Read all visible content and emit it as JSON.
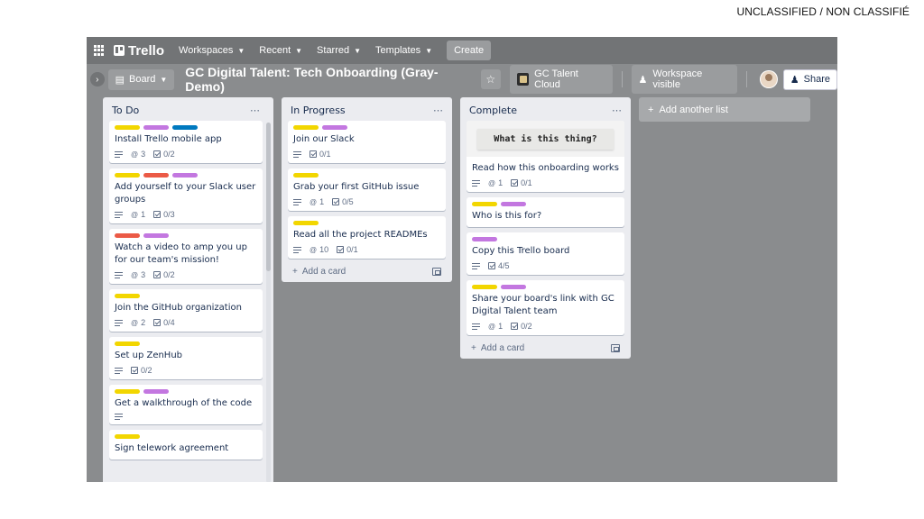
{
  "classification": "UNCLASSIFIED / NON CLASSIFIÉ",
  "colors": {
    "yellow": "#f2d600",
    "purple": "#c377e0",
    "blue": "#0079bf",
    "red": "#eb5a46"
  },
  "topnav": {
    "logo": "Trello",
    "items": [
      "Workspaces",
      "Recent",
      "Starred",
      "Templates"
    ],
    "create": "Create"
  },
  "boardbar": {
    "view": "Board",
    "title": "GC Digital Talent: Tech Onboarding (Gray-Demo)",
    "workspace": "GC Talent Cloud",
    "visibility": "Workspace visible",
    "share": "Share"
  },
  "lists": {
    "todo": {
      "title": "To Do",
      "cards": [
        {
          "title": "Install Trello mobile app",
          "labels": [
            "yellow",
            "purple",
            "blue"
          ],
          "attachments": "3",
          "checklist": "0/2"
        },
        {
          "title": "Add yourself to your Slack user groups",
          "labels": [
            "yellow",
            "red",
            "purple"
          ],
          "attachments": "1",
          "checklist": "0/3"
        },
        {
          "title": "Watch a video to amp you up for our team's mission!",
          "labels": [
            "red",
            "purple"
          ],
          "attachments": "3",
          "checklist": "0/2"
        },
        {
          "title": "Join the GitHub organization",
          "labels": [
            "yellow"
          ],
          "attachments": "2",
          "checklist": "0/4"
        },
        {
          "title": "Set up ZenHub",
          "labels": [
            "yellow"
          ],
          "checklist": "0/2"
        },
        {
          "title": "Get a walkthrough of the code",
          "labels": [
            "yellow",
            "purple"
          ]
        },
        {
          "title": "Sign telework agreement",
          "labels": [
            "yellow"
          ]
        }
      ]
    },
    "inprogress": {
      "title": "In Progress",
      "cards": [
        {
          "title": "Join our Slack",
          "labels": [
            "yellow",
            "purple"
          ],
          "checklist": "0/1"
        },
        {
          "title": "Grab your first GitHub issue",
          "labels": [
            "yellow"
          ],
          "attachments": "1",
          "checklist": "0/5"
        },
        {
          "title": "Read all the project READMEs",
          "labels": [
            "yellow"
          ],
          "attachments": "10",
          "checklist": "0/1"
        }
      ],
      "add_card": "Add a card"
    },
    "complete": {
      "title": "Complete",
      "cards": [
        {
          "title": "Read how this onboarding works",
          "cover": "What is this thing?",
          "attachments": "1",
          "checklist": "0/1"
        },
        {
          "title": "Who is this for?",
          "labels": [
            "yellow",
            "purple"
          ]
        },
        {
          "title": "Copy this Trello board",
          "labels": [
            "purple"
          ],
          "checklist": "4/5"
        },
        {
          "title": "Share your board's link with GC Digital Talent team",
          "labels": [
            "yellow",
            "purple"
          ],
          "attachments": "1",
          "checklist": "0/2"
        }
      ],
      "add_card": "Add a card"
    }
  },
  "add_list": "Add another list"
}
